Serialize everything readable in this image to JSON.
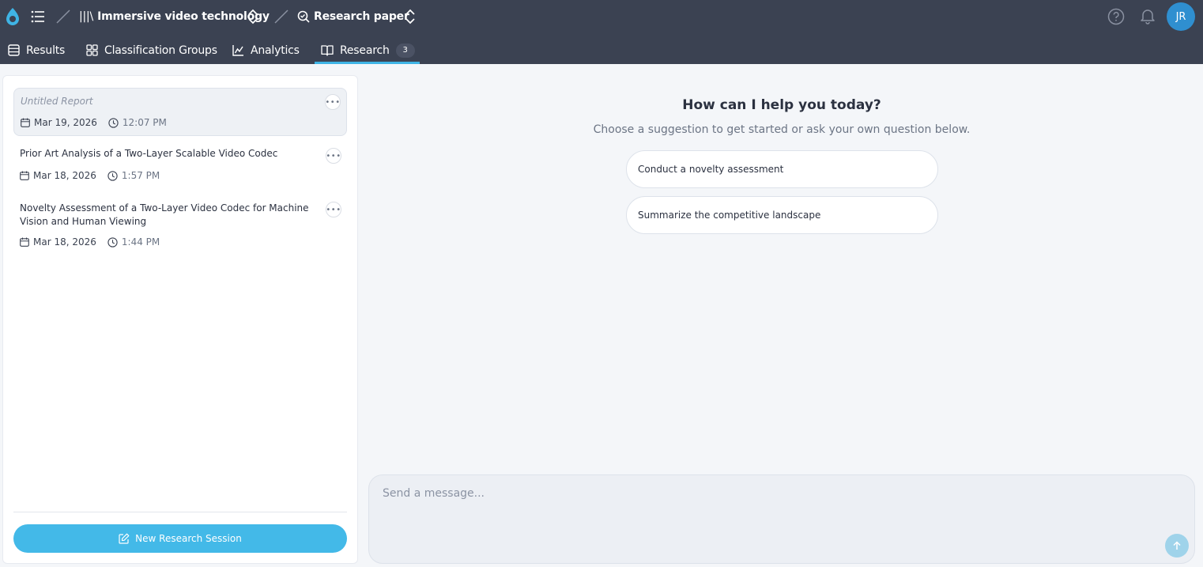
{
  "app": {
    "logo_icon": "app-logo-icon",
    "accent_color": "#43b9e8",
    "topbar_color": "#3b4252"
  },
  "breadcrumb": {
    "collection_prefix": "|||\\",
    "collection_name": "Immersive video technology",
    "query_name": "Research paper"
  },
  "header": {
    "avatar_initials": "JR"
  },
  "tabs": [
    {
      "label": "Results",
      "icon": "table-icon"
    },
    {
      "label": "Classification Groups",
      "icon": "grid-icon"
    },
    {
      "label": "Analytics",
      "icon": "chart-icon"
    },
    {
      "label": "Research",
      "icon": "book-icon",
      "badge": "3",
      "active": true
    }
  ],
  "reports": [
    {
      "title": "Untitled Report",
      "date": "Mar 19, 2026",
      "time": "12:07 PM",
      "selected": true
    },
    {
      "title": "Prior Art Analysis of a Two-Layer Scalable Video Codec",
      "date": "Mar 18, 2026",
      "time": "1:57 PM"
    },
    {
      "title": "Novelty Assessment of a Two-Layer Video Codec for Machine Vision and Human Viewing",
      "date": "Mar 18, 2026",
      "time": "1:44 PM"
    }
  ],
  "new_session_label": "New Research Session",
  "welcome": {
    "title": "How can I help you today?",
    "subtitle": "Choose a suggestion to get started or ask your own question below."
  },
  "suggestions": [
    "Conduct a novelty assessment",
    "Summarize the competitive landscape"
  ],
  "composer": {
    "placeholder": "Send a message..."
  }
}
